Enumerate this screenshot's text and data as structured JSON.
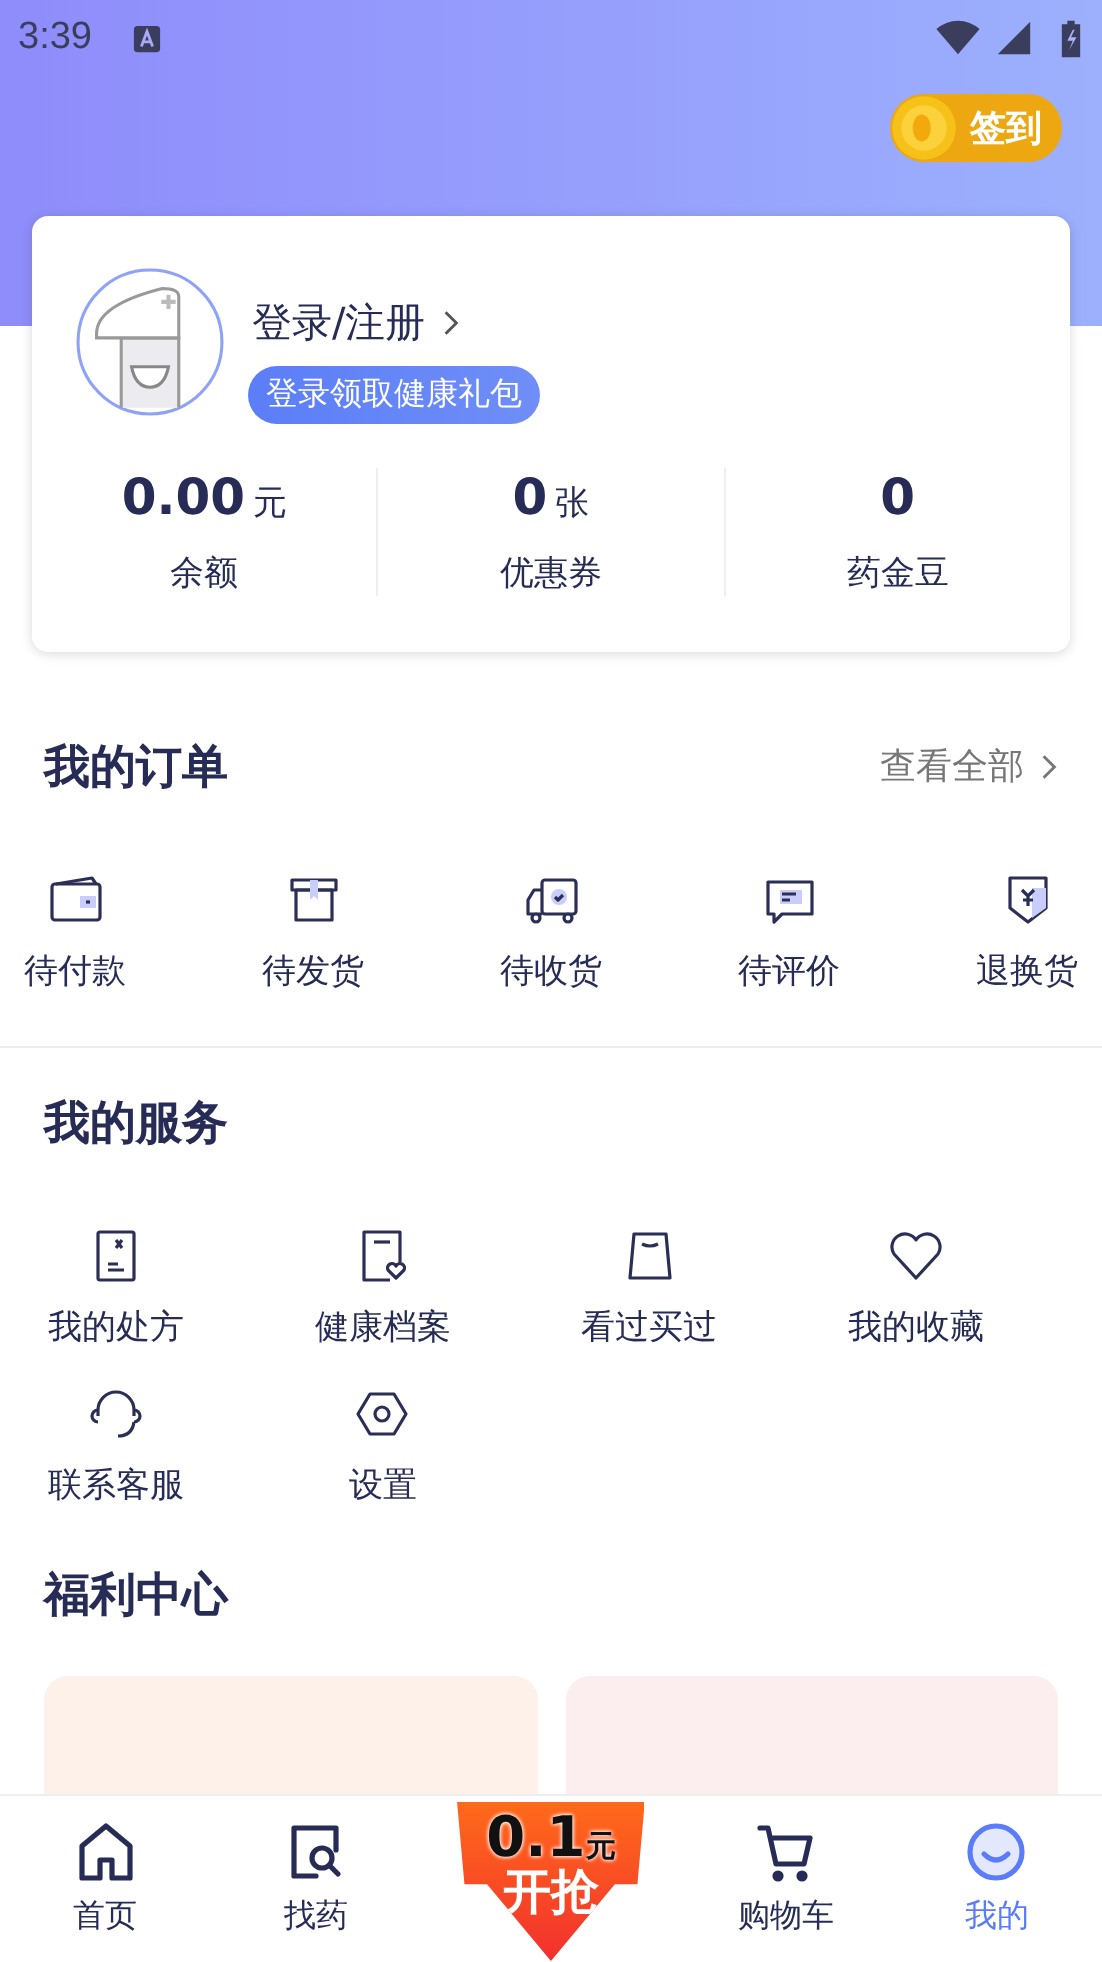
{
  "status_bar": {
    "time": "3:39"
  },
  "checkin_button": {
    "label": "签到"
  },
  "profile": {
    "login_link": "登录/注册",
    "tooltip": "登录领取健康礼包"
  },
  "stats": [
    {
      "value": "0.00",
      "unit": "元",
      "label": "余额"
    },
    {
      "value": "0",
      "unit": "张",
      "label": "优惠券"
    },
    {
      "value": "0",
      "label": "药金豆"
    }
  ],
  "orders": {
    "title": "我的订单",
    "view_all": "查看全部",
    "items": [
      {
        "label": "待付款",
        "kind": "wallet"
      },
      {
        "label": "待发货",
        "kind": "box"
      },
      {
        "label": "待收货",
        "kind": "truck"
      },
      {
        "label": "待评价",
        "kind": "comment"
      },
      {
        "label": "退换货",
        "kind": "refund"
      }
    ]
  },
  "services": {
    "title": "我的服务",
    "items": [
      {
        "label": "我的处方",
        "kind": "prescription"
      },
      {
        "label": "健康档案",
        "kind": "record"
      },
      {
        "label": "看过买过",
        "kind": "bag"
      },
      {
        "label": "我的收藏",
        "kind": "heart"
      },
      {
        "label": "联系客服",
        "kind": "headset"
      },
      {
        "label": "设置",
        "kind": "settings"
      }
    ]
  },
  "welfare": {
    "title": "福利中心",
    "cards": [
      {
        "color": "#fdf1ea"
      },
      {
        "color": "#fcedef"
      }
    ]
  },
  "nav": [
    {
      "kind": "home",
      "label": "首页",
      "selected": false
    },
    {
      "kind": "find",
      "label": "找药",
      "selected": false
    },
    {
      "kind": "promo",
      "value": "0.1",
      "unit": "元",
      "label": "开抢"
    },
    {
      "kind": "cart",
      "label": "购物车",
      "selected": false
    },
    {
      "kind": "me",
      "label": "我的",
      "selected": true
    }
  ]
}
